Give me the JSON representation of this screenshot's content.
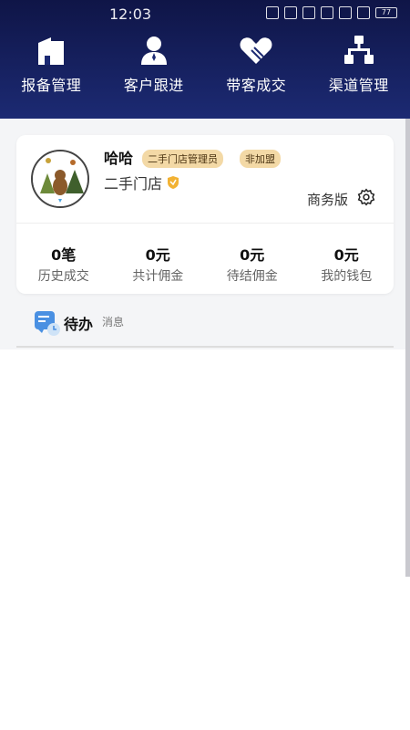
{
  "status": {
    "time": "12:03",
    "battery": "77"
  },
  "nav": {
    "items": [
      {
        "label": "报备管理",
        "icon": "building-icon"
      },
      {
        "label": "客户跟进",
        "icon": "person-icon"
      },
      {
        "label": "带客成交",
        "icon": "handshake-heart-icon"
      },
      {
        "label": "渠道管理",
        "icon": "org-chart-icon"
      }
    ]
  },
  "profile": {
    "username": "哈哈",
    "badges": [
      "二手门店管理员",
      "非加盟"
    ],
    "store_name": "二手门店",
    "plan": "商务版"
  },
  "stats": [
    {
      "value": "0笔",
      "label": "历史成交"
    },
    {
      "value": "0元",
      "label": "共计佣金"
    },
    {
      "value": "0元",
      "label": "待结佣金"
    },
    {
      "value": "0元",
      "label": "我的钱包"
    }
  ],
  "todo": {
    "title": "待办",
    "subtitle": "消息"
  },
  "colors": {
    "header_top": "#0f1547",
    "header_bottom": "#1c2a73",
    "badge_bg": "#f3d9a6"
  }
}
